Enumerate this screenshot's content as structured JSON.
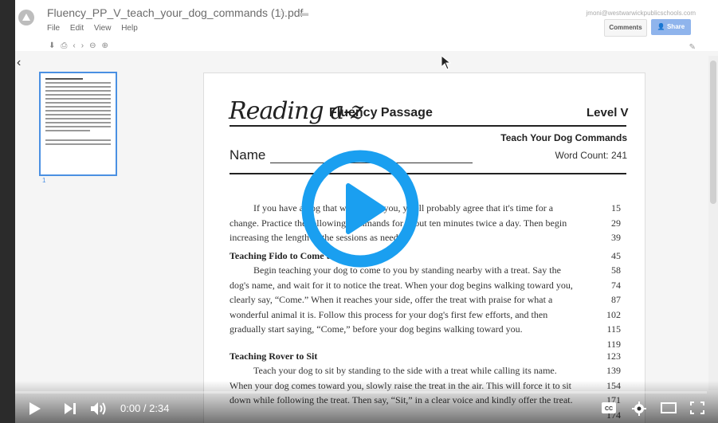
{
  "header": {
    "file_title": "Fluency_PP_V_teach_your_dog_commands (1).pdf",
    "menu": [
      "File",
      "Edit",
      "View",
      "Help"
    ],
    "user_email": "jmoni@westwarwickpublicschools.com",
    "comments_label": "Comments",
    "share_label": "Share"
  },
  "thumbnail": {
    "page_number": "1"
  },
  "document": {
    "brand": "Reading a-z",
    "subtitle": "Fluency Passage",
    "level": "Level V",
    "passage_title": "Teach Your Dog Commands",
    "name_label": "Name",
    "word_count": "Word Count: 241",
    "intro": "If you have a dog that won't obey you, you'll probably agree that it's time for a change. Practice the following commands for about ten minutes twice a day. Then begin increasing the length of the sessions as needed.",
    "intro_counts": [
      "15",
      "29",
      "39"
    ],
    "section1_heading": "Teaching Fido to Come to You",
    "section1_count": "45",
    "section1_text": "Begin teaching your dog to come to you by standing nearby with a treat. Say the dog's name, and wait for it to notice the treat. When your dog begins walking toward you, clearly say, “Come.” When it reaches your side, offer the treat with praise for what a wonderful animal it is. Follow this process for your dog's first few efforts, and then gradually start saying, “Come,” before your dog begins walking toward you.",
    "section1_counts": [
      "58",
      "74",
      "87",
      "102",
      "115",
      "119"
    ],
    "section2_heading": "Teaching Rover to Sit",
    "section2_count": "123",
    "section2_text": "Teach your dog to sit by standing to the side with a treat while calling its name. When your dog comes toward you, slowly raise the treat in the air. This will force it to sit down while following the treat. Then say, “Sit,” in a clear voice and kindly offer the treat.",
    "section2_counts": [
      "139",
      "154",
      "171",
      "174"
    ]
  },
  "player": {
    "time": "0:00 / 2:34",
    "progress": 0.0,
    "accent": "#e62117",
    "play_color": "#1a9ff0"
  }
}
